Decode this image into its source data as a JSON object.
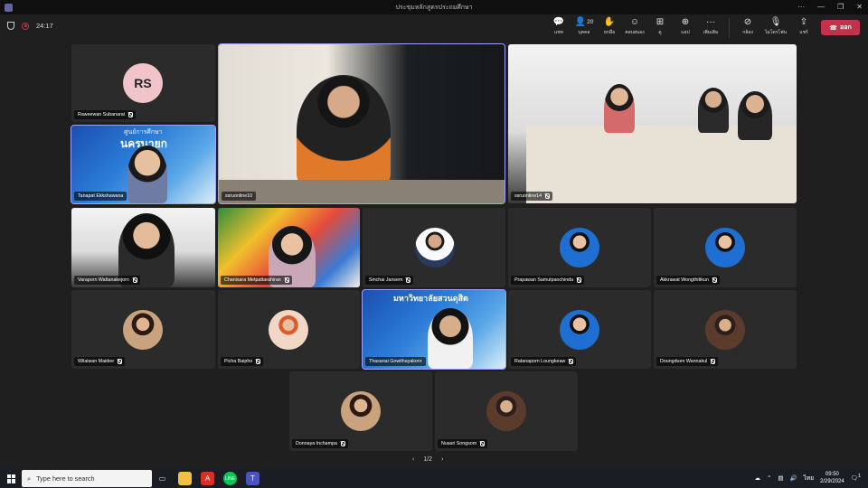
{
  "window": {
    "title": "ประชุมหลักสูตรประถมศึกษา",
    "controls": [
      "···",
      "—",
      "❐",
      "✕"
    ]
  },
  "meeting": {
    "timer": "24:17",
    "tools": [
      {
        "key": "chat",
        "label": "แชท",
        "icon": "chat-icon"
      },
      {
        "key": "people",
        "label": "บุคคล",
        "icon": "people-icon",
        "count": "20"
      },
      {
        "key": "raise",
        "label": "ยกมือ",
        "icon": "raise-hand-icon"
      },
      {
        "key": "react",
        "label": "ตอบสนอง",
        "icon": "smile-icon"
      },
      {
        "key": "view",
        "label": "ดู",
        "icon": "grid-icon"
      },
      {
        "key": "apps",
        "label": "แอป",
        "icon": "apps-icon"
      },
      {
        "key": "more",
        "label": "เพิ่มเติม",
        "icon": "more-icon"
      }
    ],
    "devices": [
      {
        "key": "camera",
        "label": "กล้อง",
        "icon": "camera-off-icon"
      },
      {
        "key": "mic",
        "label": "ไมโครโฟน",
        "icon": "mic-off-icon"
      },
      {
        "key": "share",
        "label": "แชร์",
        "icon": "share-icon"
      }
    ],
    "leave_label": "ออก"
  },
  "participants": {
    "raweewan": {
      "name": "Raweewan Subanarat",
      "initials": "RS"
    },
    "tanapat": {
      "name": "Tanapat Ekkshawana",
      "banner_line1": "ศูนย์การศึกษา",
      "banner_line2": "นครนายก"
    },
    "speaker": {
      "name": "ssruonline10"
    },
    "room14": {
      "name": "ssruonline14"
    },
    "varaporn": {
      "name": "Varaporn Wattanakejorn"
    },
    "chanisara": {
      "name": "Chanisara Metpattarahiran"
    },
    "sinchai": {
      "name": "Sinchai Jansem"
    },
    "prapawan": {
      "name": "Prapawan Samutpaochinda"
    },
    "akkrawat": {
      "name": "Akkrawat Wongthitikun"
    },
    "wilaiwan": {
      "name": "Wilaiwan Maidee"
    },
    "picha": {
      "name": "Picha Baipho"
    },
    "thasanai": {
      "name": "Thasanai Gowithayakorn",
      "banner": "มหาวิทยาลัยสวนดุสิต"
    },
    "ratanaporn": {
      "name": "Ratanaporn Loungkeaw"
    },
    "doungduen": {
      "name": "Doungduen Wannakul"
    },
    "donnaya": {
      "name": "Donnaya Inchampa"
    },
    "nuasri": {
      "name": "Nuasri Songsom"
    }
  },
  "pager": {
    "prev": "‹",
    "label": "1/2",
    "next": "›"
  },
  "taskbar": {
    "search_placeholder": "Type here to search",
    "lang": "ไทย",
    "time": "09:50",
    "date": "2/29/2024",
    "notification_count": "1"
  }
}
